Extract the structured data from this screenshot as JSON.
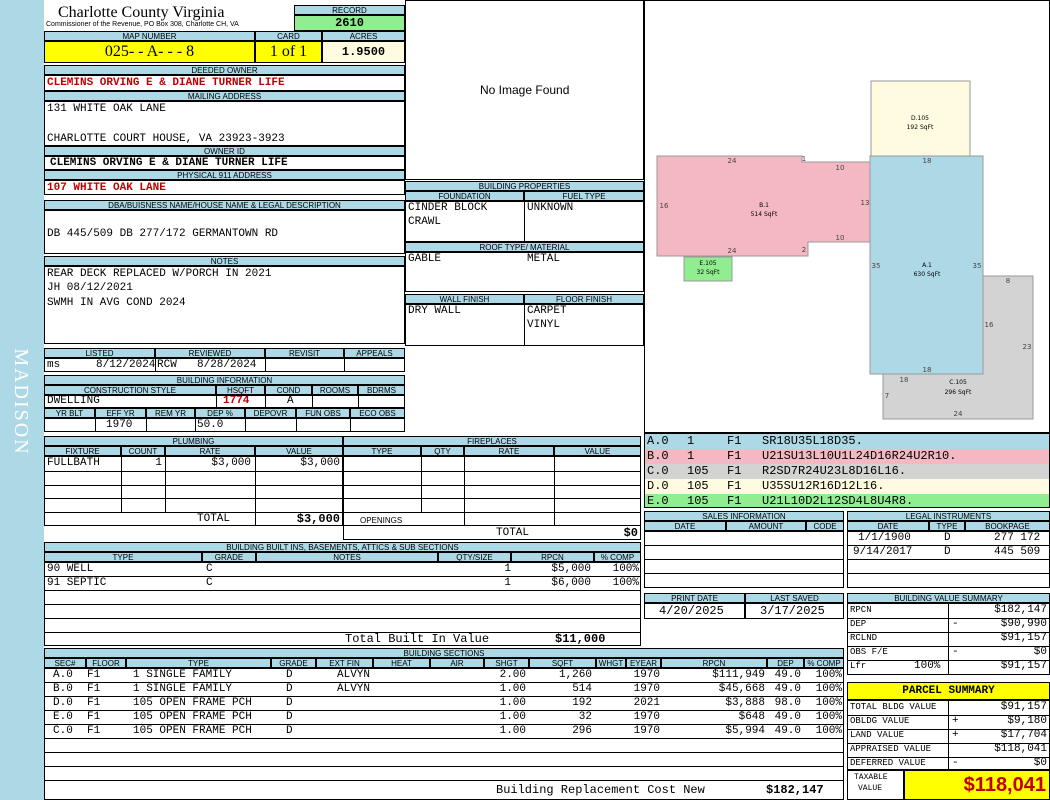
{
  "side_label": "MADISON",
  "county": "Charlotte County Virginia",
  "commissioner": "Commissioner of the Revenue, PO Box 308, Charlotte CH, VA",
  "record": {
    "label": "RECORD",
    "value": "2610"
  },
  "map": {
    "label": "MAP NUMBER",
    "value": "025- - A- - - 8"
  },
  "card": {
    "label": "CARD",
    "value": "1 of 1"
  },
  "acres": {
    "label": "ACRES",
    "value": "1.9500"
  },
  "owner": {
    "label": "DEEDED OWNER",
    "value": "CLEMINS ORVING E & DIANE TURNER LIFE"
  },
  "mailing": {
    "label": "MAILING ADDRESS",
    "line1": "131 WHITE OAK LANE",
    "line2": "CHARLOTTE COURT HOUSE, VA 23923-3923"
  },
  "owner_id": {
    "label": "OWNER ID",
    "value": "CLEMINS ORVING E & DIANE TURNER LIFE"
  },
  "physical": {
    "label": "PHYSICAL 911 ADDRESS",
    "value": "107 WHITE OAK LANE"
  },
  "dba": {
    "label": "DBA/BUISNESS NAME/HOUSE NAME & LEGAL DESCRIPTION",
    "value": "DB 445/509 DB 277/172 GERMANTOWN RD"
  },
  "notes": {
    "label": "NOTES",
    "lines": [
      "REAR DECK REPLACED W/PORCH IN 2021",
      "JH 08/12/2021",
      "SWMH IN AVG COND 2024"
    ]
  },
  "listed": {
    "label": "LISTED",
    "by": "ms",
    "date": "8/12/2024"
  },
  "reviewed": {
    "label": "REVIEWED",
    "by": "RCW",
    "date": "8/28/2024"
  },
  "revisit": {
    "label": "REVISIT"
  },
  "appeals": {
    "label": "APPEALS"
  },
  "bldg_info": {
    "label": "BUILDING INFORMATION",
    "cs_label": "CONSTRUCTION STYLE",
    "hsqft_label": "HSQFT",
    "cond_label": "COND",
    "rooms_label": "ROOMS",
    "bdrms_label": "BDRMS",
    "style": "DWELLING",
    "hsqft": "1774",
    "cond": "A",
    "yrblt_label": "YR BLT",
    "effyr_label": "EFF YR",
    "remyr_label": "REM YR",
    "dep_label": "DEP %",
    "depovr_label": "DEPOVR",
    "funobs_label": "FUN OBS",
    "ecoobs_label": "ECO OBS",
    "effyr": "1970",
    "dep": "50.0"
  },
  "image": {
    "text": "No Image Found"
  },
  "bldg_props": {
    "label": "BUILDING PROPERTIES",
    "foundation_label": "FOUNDATION",
    "fuel_label": "FUEL TYPE",
    "foundation1": "CINDER BLOCK",
    "foundation2": "CRAWL",
    "fuel": "UNKNOWN",
    "roof_label": "ROOF TYPE/ MATERIAL",
    "roof_type": "GABLE",
    "roof_mat": "METAL",
    "wall_label": "WALL FINISH",
    "floor_label": "FLOOR FINISH",
    "wall": "DRY WALL",
    "floor1": "CARPET",
    "floor2": "VINYL"
  },
  "sketch": {
    "D": {
      "name": "D.105",
      "area": "192 SqFt"
    },
    "B": {
      "name": "B.1",
      "area": "514 SqFt"
    },
    "E": {
      "name": "E.105",
      "area": "32 SqFt"
    },
    "A": {
      "name": "A.1",
      "area": "630 SqFt"
    },
    "C": {
      "name": "C.105",
      "area": "296 SqFt"
    },
    "dims": {
      "b_top": "24",
      "b_top2": "1",
      "b_top3": "10",
      "b_left": "16",
      "b_right": "13",
      "b_bot": "24",
      "b_bot2": "2",
      "b_bot3": "10",
      "a_top": "18",
      "a_left": "35",
      "a_right": "35",
      "a_bot": "18",
      "c_top": "8",
      "c_r1": "16",
      "c_r2": "23",
      "c_left": "7",
      "c_top2": "18",
      "c_bot": "24"
    }
  },
  "sketch_codes": [
    {
      "id": "A.0",
      "n": "1",
      "f": "F1",
      "code": "SR18U35L18D35.",
      "color": "#add8e6"
    },
    {
      "id": "B.0",
      "n": "1",
      "f": "F1",
      "code": "U21SU13L10U1L24D16R24U2R10.",
      "color": "#f4b8c2"
    },
    {
      "id": "C.0",
      "n": "105",
      "f": "F1",
      "code": "R2SD7R24U23L8D16L16.",
      "color": "#d3d3d3"
    },
    {
      "id": "D.0",
      "n": "105",
      "f": "F1",
      "code": "U35SU12R16D12L16.",
      "color": "#fffbe0"
    },
    {
      "id": "E.0",
      "n": "105",
      "f": "F1",
      "code": "U21L10D2L12SD4L8U4R8.",
      "color": "#90ee90"
    }
  ],
  "plumbing": {
    "label": "PLUMBING",
    "headers": [
      "FIXTURE",
      "COUNT",
      "RATE",
      "VALUE"
    ],
    "rows": [
      [
        "FULLBATH",
        "1",
        "$3,000",
        "$3,000"
      ]
    ],
    "total_label": "TOTAL",
    "total": "$3,000"
  },
  "fireplaces": {
    "label": "FIREPLACES",
    "headers": [
      "TYPE",
      "QTY",
      "RATE",
      "VALUE"
    ],
    "openings_label": "OPENINGS",
    "total_label": "TOTAL",
    "total": "$0"
  },
  "builtins": {
    "label": "BUILDING BUILT INS, BASEMENTS, ATTICS & SUB SECTIONS",
    "headers": [
      "TYPE",
      "GRADE",
      "NOTES",
      "QTY/SIZE",
      "RPCN",
      "% COMP"
    ],
    "rows": [
      [
        "90 WELL",
        "C",
        "",
        "1",
        "$5,000",
        "100%"
      ],
      [
        "91 SEPTIC",
        "C",
        "",
        "1",
        "$6,000",
        "100%"
      ]
    ],
    "total_label": "Total Built In Value",
    "total": "$11,000"
  },
  "sales": {
    "label": "SALES INFORMATION",
    "headers": [
      "DATE",
      "AMOUNT",
      "CODE"
    ]
  },
  "legal": {
    "label": "LEGAL INSTRUMENTS",
    "headers": [
      "DATE",
      "TYPE",
      "BOOKPAGE"
    ],
    "rows": [
      [
        "1/1/1900",
        "D",
        "277 172"
      ],
      [
        "9/14/2017",
        "D",
        "445 509"
      ]
    ]
  },
  "print": {
    "label": "PRINT DATE",
    "value": "4/20/2025"
  },
  "saved": {
    "label": "LAST SAVED",
    "value": "3/17/2025"
  },
  "bvs": {
    "label": "BUILDING VALUE SUMMARY",
    "rows": [
      {
        "k": "RPCN",
        "s": "",
        "v": "$182,147"
      },
      {
        "k": "DEP",
        "s": "-",
        "v": "$90,990"
      },
      {
        "k": "RCLND",
        "s": "",
        "v": "$91,157"
      },
      {
        "k": "OBS F/E",
        "s": "-",
        "v": "$0"
      },
      {
        "k": "Lfr",
        "p": "100%",
        "s": "",
        "v": "$91,157"
      }
    ]
  },
  "parcel": {
    "label": "PARCEL SUMMARY",
    "rows": [
      {
        "k": "TOTAL BLDG VALUE",
        "s": "",
        "v": "$91,157"
      },
      {
        "k": "OBLDG VALUE",
        "s": "+",
        "v": "$9,180"
      },
      {
        "k": "LAND VALUE",
        "s": "+",
        "v": "$17,704"
      },
      {
        "k": "APPRAISED VALUE",
        "s": "",
        "v": "$118,041"
      },
      {
        "k": "DEFERRED VALUE",
        "s": "-",
        "v": "$0"
      }
    ],
    "taxable_label1": "TAXABLE",
    "taxable_label2": "VALUE",
    "taxable": "$118,041"
  },
  "sections": {
    "label": "BUILDING SECTIONS",
    "headers": [
      "SEC#",
      "FLOOR",
      "TYPE",
      "GRADE",
      "EXT FIN",
      "HEAT",
      "AIR",
      "SHGT",
      "SQFT",
      "WHGT",
      "EYEAR",
      "RPCN",
      "DEP",
      "% COMP"
    ],
    "rows": [
      [
        "A.0",
        "F1",
        "1 SINGLE FAMILY",
        "D",
        "ALVYN",
        "",
        "",
        "2.00",
        "1,260",
        "",
        "1970",
        "$111,949",
        "49.0",
        "100%"
      ],
      [
        "B.0",
        "F1",
        "1 SINGLE FAMILY",
        "D",
        "ALVYN",
        "",
        "",
        "1.00",
        "514",
        "",
        "1970",
        "$45,668",
        "49.0",
        "100%"
      ],
      [
        "D.0",
        "F1",
        "105 OPEN FRAME PCH",
        "D",
        "",
        "",
        "",
        "1.00",
        "192",
        "",
        "2021",
        "$3,888",
        "98.0",
        "100%"
      ],
      [
        "E.0",
        "F1",
        "105 OPEN FRAME PCH",
        "D",
        "",
        "",
        "",
        "1.00",
        "32",
        "",
        "1970",
        "$648",
        "49.0",
        "100%"
      ],
      [
        "C.0",
        "F1",
        "105 OPEN FRAME PCH",
        "D",
        "",
        "",
        "",
        "1.00",
        "296",
        "",
        "1970",
        "$5,994",
        "49.0",
        "100%"
      ]
    ],
    "total_label": "Building Replacement Cost New",
    "total": "$182,147"
  }
}
